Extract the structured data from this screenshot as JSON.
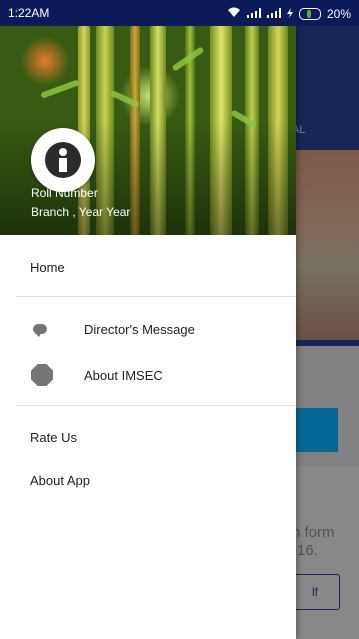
{
  "status_bar": {
    "time": "1:22AM",
    "battery_percent": "20%",
    "icons": [
      "wifi-icon",
      "signal-icon",
      "signal-icon",
      "charging-icon",
      "battery-icon"
    ],
    "battery_level": 0.2
  },
  "drawer": {
    "header": {
      "roll_number": "Roll Number",
      "branch_year": "Branch , Year Year"
    },
    "primary_items": [
      {
        "label": "Home"
      }
    ],
    "icon_items": [
      {
        "label": "Director's Message",
        "icon": "chat-bubble-icon"
      },
      {
        "label": "About IMSEC",
        "icon": "octagon-icon"
      }
    ],
    "secondary_items": [
      {
        "label": "Rate Us"
      },
      {
        "label": "About App"
      }
    ]
  },
  "background": {
    "tab_partial": "AL",
    "form_text_line1": "n form",
    "form_text_line2": "-16.",
    "pdf_button": "lf"
  },
  "colors": {
    "status_bar_bg": "#0c1a5a",
    "app_primary": "#243b86",
    "accent": "#0aa0e6"
  }
}
